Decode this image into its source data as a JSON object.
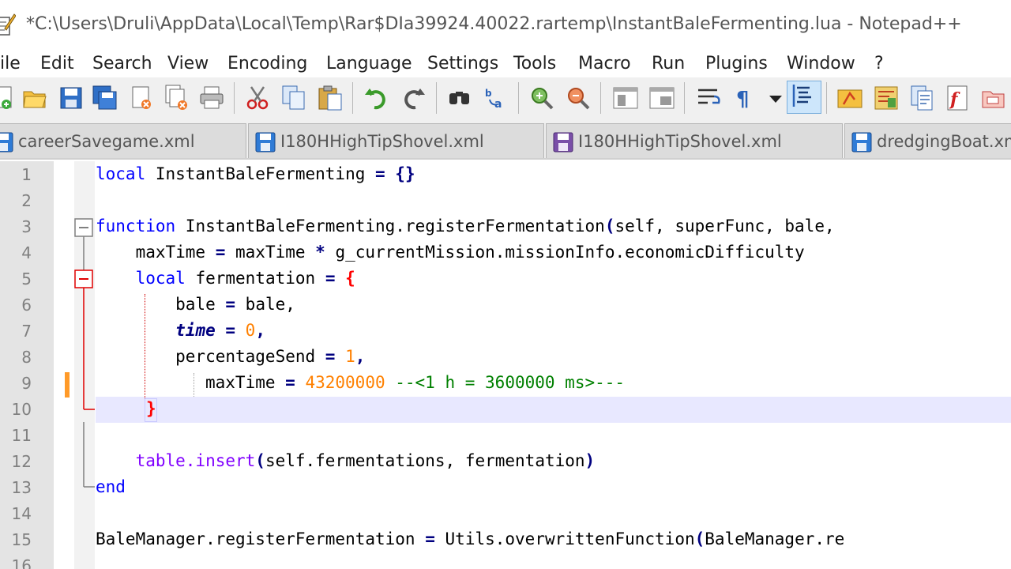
{
  "window": {
    "title": "*C:\\Users\\Druli\\AppData\\Local\\Temp\\Rar$DIa39924.40022.rartemp\\InstantBaleFermenting.lua - Notepad++"
  },
  "menu": [
    "ile",
    "Edit",
    "Search",
    "View",
    "Encoding",
    "Language",
    "Settings",
    "Tools",
    "Macro",
    "Run",
    "Plugins",
    "Window",
    "?"
  ],
  "toolbar": {
    "buttons": [
      "new-file-icon",
      "open-file-icon",
      "save-icon",
      "save-all-icon",
      "close-icon",
      "close-all-icon",
      "print-icon",
      "cut-icon",
      "copy-icon",
      "paste-icon",
      "undo-icon",
      "redo-icon",
      "find-icon",
      "replace-icon",
      "zoom-in-icon",
      "zoom-out-icon",
      "sync-vertical-icon",
      "sync-horizontal-icon",
      "word-wrap-icon",
      "show-all-characters-icon",
      "dropdown-icon",
      "indent-guide-icon",
      "user-defined-language-icon",
      "document-map-icon",
      "document-list-icon",
      "function-list-icon",
      "folder-as-workspace-icon"
    ]
  },
  "tabs": [
    {
      "label": "careerSavegame.xml",
      "icon": "saved-file-icon",
      "color": "#2f7bd6"
    },
    {
      "label": "I180HHighTipShovel.xml",
      "icon": "saved-file-icon",
      "color": "#2f7bd6"
    },
    {
      "label": "I180HHighTipShovel.xml",
      "icon": "saved-file-icon",
      "color": "#7a4fa8"
    },
    {
      "label": "dredgingBoat.xm",
      "icon": "saved-file-icon",
      "color": "#2f7bd6"
    }
  ],
  "editor": {
    "line_numbers": [
      "1",
      "2",
      "3",
      "4",
      "5",
      "6",
      "7",
      "8",
      "9",
      "10",
      "11",
      "12",
      "13",
      "14",
      "15",
      "16"
    ],
    "lines": {
      "l1_kw": "local",
      "l1_rest": " InstantBaleFermenting ",
      "l1_op": "= {}",
      "l3_kw": "function",
      "l3_rest": " InstantBaleFermenting.registerFermentation",
      "l3_op": "(",
      "l3_args": "self, superFunc, bale,",
      "l4_a": "    maxTime ",
      "l4_op1": "=",
      "l4_b": " maxTime ",
      "l4_op2": "*",
      "l4_c": " g_currentMission.missionInfo.economicDifficulty",
      "l5_kw": "    local",
      "l5_rest": " fermentation ",
      "l5_op": "=",
      "l5_brace": " {",
      "l6_a": "        bale ",
      "l6_op": "=",
      "l6_b": " bale,",
      "l7_kw": "time",
      "l7_op": " =",
      "l7_num": " 0",
      "l7_end": ",",
      "l8_a": "        percentageSend ",
      "l8_op": "=",
      "l8_num": " 1",
      "l8_end": ",",
      "l9_a": "maxTime ",
      "l9_op": "=",
      "l9_num": " 43200000",
      "l9_cmt": " --<1 h = 3600000 ms>---",
      "l10_brace": "}",
      "l12_fn": "table.insert",
      "l12_op": "(",
      "l12_args": "self.fermentations, fermentation",
      "l12_close": ")",
      "l13_kw": "end",
      "l15_a": "BaleManager.registerFermentation ",
      "l15_op": "=",
      "l15_b": " Utils.overwrittenFunction",
      "l15_op2": "(",
      "l15_c": "BaleManager.re"
    }
  }
}
